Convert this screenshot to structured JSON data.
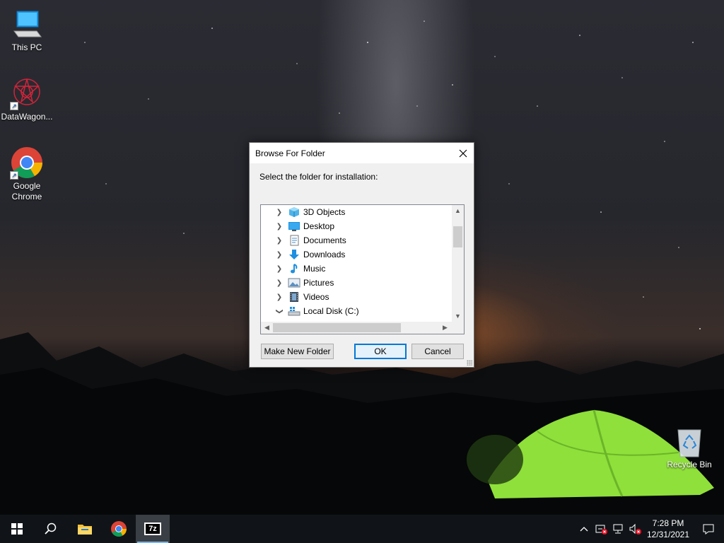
{
  "desktop": {
    "icons": [
      {
        "label": "This PC"
      },
      {
        "label": "DataWagon..."
      },
      {
        "label": "Google Chrome"
      },
      {
        "label": "Recycle Bin"
      }
    ]
  },
  "dialog": {
    "title": "Browse For Folder",
    "instruction": "Select the folder for installation:",
    "tree_items": [
      {
        "label": "3D Objects",
        "icon": "3d-objects-icon",
        "expanded": false
      },
      {
        "label": "Desktop",
        "icon": "desktop-folder-icon",
        "expanded": false
      },
      {
        "label": "Documents",
        "icon": "documents-icon",
        "expanded": false
      },
      {
        "label": "Downloads",
        "icon": "downloads-icon",
        "expanded": false
      },
      {
        "label": "Music",
        "icon": "music-icon",
        "expanded": false
      },
      {
        "label": "Pictures",
        "icon": "pictures-icon",
        "expanded": false
      },
      {
        "label": "Videos",
        "icon": "videos-icon",
        "expanded": false
      },
      {
        "label": "Local Disk (C:)",
        "icon": "drive-icon",
        "expanded": true
      }
    ],
    "buttons": {
      "make_new_folder": "Make New Folder",
      "ok": "OK",
      "cancel": "Cancel"
    }
  },
  "taskbar": {
    "apps": [
      "start-icon",
      "search-icon",
      "file-explorer-icon",
      "chrome-icon",
      "7zip-icon"
    ],
    "active_app_label": "7z",
    "clock": {
      "time": "7:28 PM",
      "date": "12/31/2021"
    }
  },
  "colors": {
    "accent": "#0078d7",
    "taskbar": "#101418",
    "tent": "#8fe03a"
  }
}
